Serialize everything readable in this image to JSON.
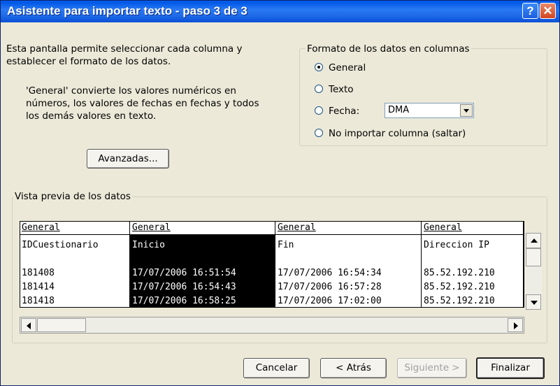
{
  "window": {
    "title": "Asistente para importar texto - paso 3 de 3",
    "help_glyph": "?",
    "close_glyph": "✕"
  },
  "intro": {
    "line1": "Esta pantalla permite seleccionar cada columna y",
    "line2": "establecer el formato de los datos.",
    "desc1": "'General' convierte los valores numéricos en",
    "desc2": "números, los valores de fechas en fechas y todos",
    "desc3": "los demás valores en texto."
  },
  "advanced_button": "Avanzadas...",
  "format_group": {
    "legend": "Formato de los datos en columnas",
    "options": [
      {
        "label": "General",
        "selected": true
      },
      {
        "label": "Texto",
        "selected": false
      },
      {
        "label": "Fecha:",
        "selected": false
      },
      {
        "label": "No importar columna (saltar)",
        "selected": false
      }
    ],
    "date_format": "DMA"
  },
  "preview": {
    "legend": "Vista previa de los datos",
    "columns": [
      "General",
      "General",
      "General",
      "General"
    ],
    "rows": [
      [
        "IDCuestionario",
        "Inicio",
        "Fin",
        "Direccion IP"
      ],
      [
        "",
        "",
        "",
        ""
      ],
      [
        "181408",
        "17/07/2006 16:51:54",
        "17/07/2006 16:54:34",
        "85.52.192.210"
      ],
      [
        "181414",
        "17/07/2006 16:54:43",
        "17/07/2006 16:57:28",
        "85.52.192.210"
      ],
      [
        "181418",
        "17/07/2006 16:58:25",
        "17/07/2006 17:02:00",
        "85.52.192.210"
      ]
    ],
    "selected_column": 1
  },
  "buttons": {
    "cancel": "Cancelar",
    "back": "< Atrás",
    "next": "Siguiente >",
    "finish": "Finalizar"
  }
}
